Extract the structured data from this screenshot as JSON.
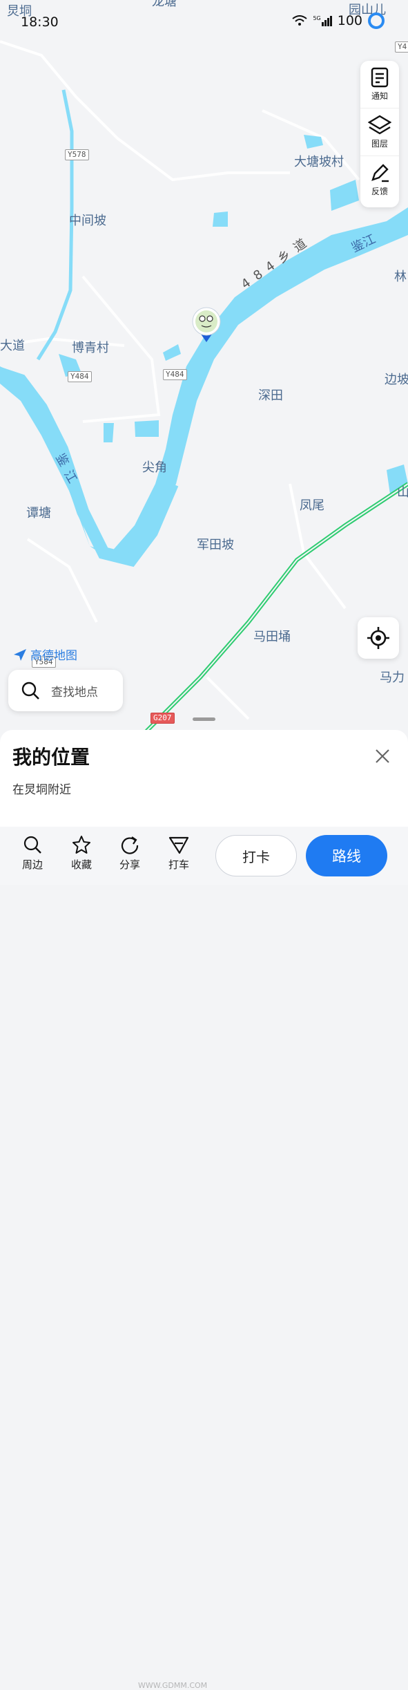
{
  "status_bar": {
    "time": "18:30",
    "network": "5G",
    "battery": "100"
  },
  "side_panel": {
    "items": [
      {
        "label": "通知",
        "icon": "notice-icon"
      },
      {
        "label": "图层",
        "icon": "layers-icon"
      },
      {
        "label": "反馈",
        "icon": "feedback-icon"
      }
    ]
  },
  "map": {
    "places": {
      "top_left": "炅垌",
      "top_center": "龙塘",
      "top_right": "园山儿",
      "datang": "大塘坡村",
      "zhongjian": "中间坡",
      "boqing": "博青村",
      "dadao": "大道",
      "shentian": "深田",
      "jianjiao": "尖角",
      "tantang": "谭塘",
      "fengwei": "凤尾",
      "juntian": "军田坡",
      "matian": "马田埇",
      "lin": "林",
      "bianpo": "边坡",
      "shan": "山",
      "mali": "马力"
    },
    "rivers": {
      "main_upper": "鉴江",
      "main_lower_a": "鉴",
      "main_lower_b": "江"
    },
    "road_name": "484乡道",
    "shields": {
      "y578": "Y578",
      "y484_a": "Y484",
      "y484_b": "Y484",
      "y584": "Y584",
      "g207": "G207",
      "y4": "Y4"
    }
  },
  "logo": "高德地图",
  "search": {
    "placeholder": "查找地点"
  },
  "sheet": {
    "title": "我的位置",
    "subtitle": "在炅垌附近"
  },
  "bottom_bar": {
    "tools": [
      {
        "label": "周边"
      },
      {
        "label": "收藏"
      },
      {
        "label": "分享"
      },
      {
        "label": "打车"
      }
    ],
    "checkin": "打卡",
    "route": "路线"
  },
  "watermark": "WWW.GDMM.COM",
  "colors": {
    "water": "#86dcf8",
    "accent": "#1f7bf2",
    "highway": "#2ecc71"
  }
}
